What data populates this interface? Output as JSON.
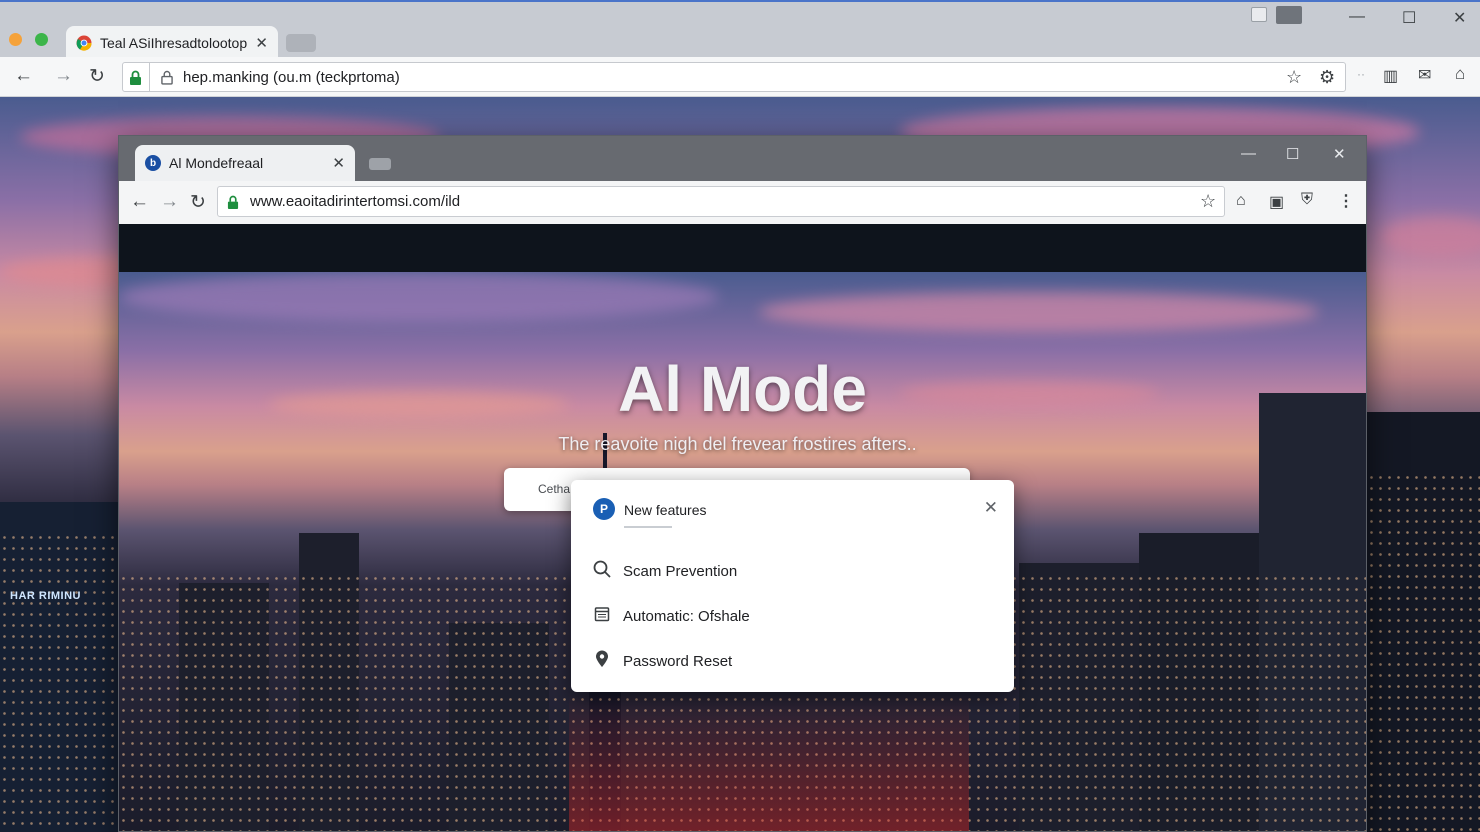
{
  "outer": {
    "tab_title": "Teal ASiIhresadtolootop",
    "url": "hep.manking (ou.m (teckprtoma)"
  },
  "inner": {
    "tab_title": "Al Mondefreaal",
    "tab_favicon": "b",
    "url": "www.eaoitadirintertomsi.com/ild"
  },
  "hero": {
    "title": "Al Mode",
    "subtitle": "The reavoite nigh del frevear frostires afters.."
  },
  "search": {
    "placeholder": "Cetha"
  },
  "popup": {
    "logo": "P",
    "title": "New features",
    "items": [
      {
        "icon": "search-icon",
        "label": "Scam Prevention"
      },
      {
        "icon": "calendar-icon",
        "label": "Automatic: Ofshale"
      },
      {
        "icon": "location-pin-icon",
        "label": "Password Reset"
      }
    ]
  },
  "background": {
    "sign_text": "HAR RIMINU"
  },
  "colors": {
    "accent": "#1a5fb4",
    "secure_lock": "#1e8e3e"
  }
}
